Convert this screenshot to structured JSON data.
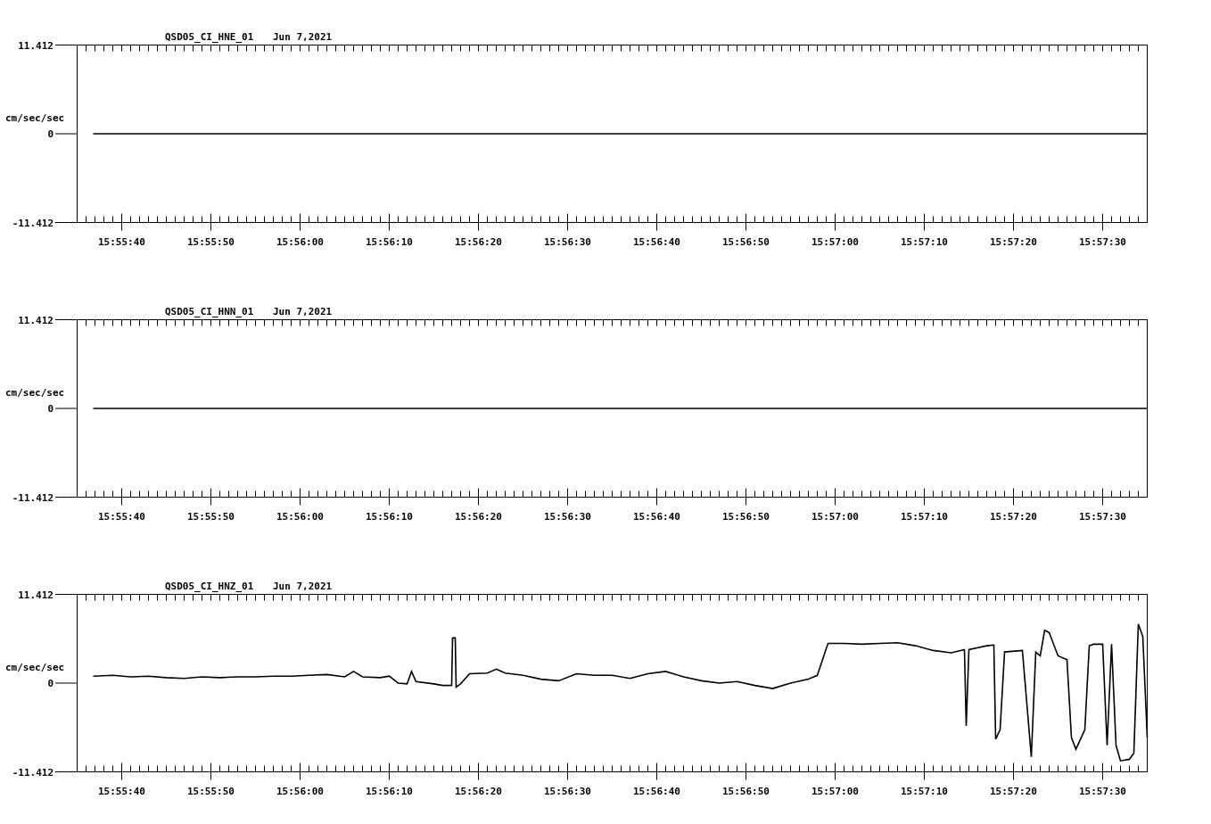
{
  "panels": [
    {
      "date": "Jun 7,2021",
      "chart_data": {
        "type": "line",
        "title": "QSD05_CI_HNE_01",
        "ylabel": "cm/sec/sec",
        "x": [
          57336.8,
          57455
        ],
        "series": [
          {
            "color": "#000000",
            "values": [
              0,
              0
            ]
          }
        ],
        "xlim": [
          57335,
          57455
        ],
        "ylim": [
          -11.412,
          11.412
        ],
        "yticks": [
          {
            "value": 11.412,
            "label": "11.412"
          },
          {
            "value": 0,
            "label": "0"
          },
          {
            "value": -11.412,
            "label": "-11.412"
          }
        ],
        "xticks": [
          {
            "value": 57340,
            "label": "15:55:40"
          },
          {
            "value": 57350,
            "label": "15:55:50"
          },
          {
            "value": 57360,
            "label": "15:56:00"
          },
          {
            "value": 57370,
            "label": "15:56:10"
          },
          {
            "value": 57380,
            "label": "15:56:20"
          },
          {
            "value": 57390,
            "label": "15:56:30"
          },
          {
            "value": 57400,
            "label": "15:56:40"
          },
          {
            "value": 57410,
            "label": "15:56:50"
          },
          {
            "value": 57420,
            "label": "15:57:00"
          },
          {
            "value": 57430,
            "label": "15:57:10"
          },
          {
            "value": 57440,
            "label": "15:57:20"
          },
          {
            "value": 57450,
            "label": "15:57:30"
          }
        ]
      }
    },
    {
      "date": "Jun 7,2021",
      "chart_data": {
        "type": "line",
        "title": "QSD05_CI_HNN_01",
        "ylabel": "cm/sec/sec",
        "x": [
          57336.8,
          57455
        ],
        "series": [
          {
            "color": "#000000",
            "values": [
              0,
              0
            ]
          }
        ],
        "xlim": [
          57335,
          57455
        ],
        "ylim": [
          -11.412,
          11.412
        ],
        "yticks": [
          {
            "value": 11.412,
            "label": "11.412"
          },
          {
            "value": 0,
            "label": "0"
          },
          {
            "value": -11.412,
            "label": "-11.412"
          }
        ],
        "xticks": [
          {
            "value": 57340,
            "label": "15:55:40"
          },
          {
            "value": 57350,
            "label": "15:55:50"
          },
          {
            "value": 57360,
            "label": "15:56:00"
          },
          {
            "value": 57370,
            "label": "15:56:10"
          },
          {
            "value": 57380,
            "label": "15:56:20"
          },
          {
            "value": 57390,
            "label": "15:56:30"
          },
          {
            "value": 57400,
            "label": "15:56:40"
          },
          {
            "value": 57410,
            "label": "15:56:50"
          },
          {
            "value": 57420,
            "label": "15:57:00"
          },
          {
            "value": 57430,
            "label": "15:57:10"
          },
          {
            "value": 57440,
            "label": "15:57:20"
          },
          {
            "value": 57450,
            "label": "15:57:30"
          }
        ]
      }
    },
    {
      "date": "Jun 7,2021",
      "chart_data": {
        "type": "line",
        "title": "QSD05_CI_HNZ_01",
        "ylabel": "cm/sec/sec",
        "x": [
          57336.8,
          57339,
          57341,
          57343,
          57345,
          57347,
          57349,
          57351,
          57353,
          57355,
          57357,
          57359,
          57361,
          57363,
          57365,
          57366,
          57367,
          57369,
          57370,
          57371,
          57372,
          57372.5,
          57373,
          57375,
          57376,
          57377,
          57377.1,
          57377.4,
          57377.5,
          57378,
          57379,
          57381,
          57382,
          57383,
          57385,
          57387,
          57389,
          57391,
          57393,
          57395,
          57397,
          57399,
          57401,
          57403,
          57405,
          57407,
          57409,
          57411,
          57413,
          57415,
          57417,
          57418,
          57419.2,
          57421,
          57423,
          57425,
          57427,
          57429,
          57431,
          57433,
          57434.5,
          57434.7,
          57435,
          57437,
          57437.8,
          57438,
          57438.5,
          57439,
          57441,
          57442,
          57442.5,
          57443,
          57443.5,
          57444,
          57445,
          57446,
          57446.5,
          57447,
          57448,
          57448.5,
          57449,
          57450,
          57450.5,
          57451,
          57451.5,
          57452,
          57453,
          57453.5,
          57454,
          57454.5,
          57455
        ],
        "series": [
          {
            "color": "#000000",
            "values": [
              0.9,
              1.0,
              0.8,
              0.9,
              0.7,
              0.6,
              0.8,
              0.7,
              0.8,
              0.8,
              0.9,
              0.9,
              1.0,
              1.1,
              0.8,
              1.5,
              0.8,
              0.7,
              0.9,
              0.0,
              -0.1,
              1.5,
              0.2,
              -0.1,
              -0.3,
              -0.3,
              5.8,
              5.8,
              -0.5,
              -0.1,
              1.2,
              1.3,
              1.8,
              1.3,
              1.0,
              0.5,
              0.3,
              1.2,
              1.0,
              1.0,
              0.6,
              1.2,
              1.5,
              0.8,
              0.3,
              0.0,
              0.2,
              -0.3,
              -0.7,
              0.0,
              0.5,
              1.0,
              5.1,
              5.1,
              5.0,
              5.1,
              5.2,
              4.8,
              4.2,
              3.9,
              4.3,
              -5.5,
              4.3,
              4.8,
              4.9,
              -7.2,
              -6.0,
              4.0,
              4.2,
              -9.5,
              4.0,
              3.5,
              6.8,
              6.5,
              3.5,
              3.0,
              -7.0,
              -8.5,
              -6.0,
              4.8,
              5.0,
              5.0,
              -8.0,
              5.0,
              -8.0,
              -10.0,
              -9.8,
              -9.0,
              7.6,
              6.0,
              -7.0
            ]
          }
        ],
        "xlim": [
          57335,
          57455
        ],
        "ylim": [
          -11.412,
          11.412
        ],
        "yticks": [
          {
            "value": 11.412,
            "label": "11.412"
          },
          {
            "value": 0,
            "label": "0"
          },
          {
            "value": -11.412,
            "label": "-11.412"
          }
        ],
        "xticks": [
          {
            "value": 57340,
            "label": "15:55:40"
          },
          {
            "value": 57350,
            "label": "15:55:50"
          },
          {
            "value": 57360,
            "label": "15:56:00"
          },
          {
            "value": 57370,
            "label": "15:56:10"
          },
          {
            "value": 57380,
            "label": "15:56:20"
          },
          {
            "value": 57390,
            "label": "15:56:30"
          },
          {
            "value": 57400,
            "label": "15:56:40"
          },
          {
            "value": 57410,
            "label": "15:56:50"
          },
          {
            "value": 57420,
            "label": "15:57:00"
          },
          {
            "value": 57430,
            "label": "15:57:10"
          },
          {
            "value": 57440,
            "label": "15:57:20"
          },
          {
            "value": 57450,
            "label": "15:57:30"
          }
        ]
      }
    }
  ]
}
